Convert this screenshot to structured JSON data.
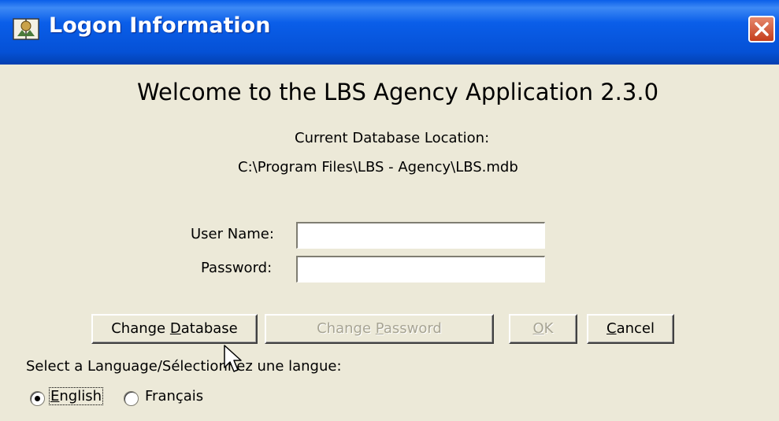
{
  "window": {
    "title": "Logon Information",
    "title_icon": "app-book-icon"
  },
  "welcome": "Welcome to the LBS Agency Application  2.3.0",
  "database": {
    "label": "Current Database Location:",
    "path": "C:\\Program Files\\LBS - Agency\\LBS.mdb"
  },
  "form": {
    "username_label": "User Name:",
    "username_value": "",
    "password_label": "Password:",
    "password_value": ""
  },
  "buttons": {
    "change_database": {
      "pre": "Change ",
      "key": "D",
      "post": "atabase"
    },
    "change_password": {
      "pre": "Change ",
      "key": "P",
      "post": "assword"
    },
    "ok": {
      "pre": "",
      "key": "O",
      "post": "K"
    },
    "cancel": {
      "pre": "",
      "key": "C",
      "post": "ancel"
    }
  },
  "language": {
    "prompt": "Select a Language/Sélectionnez une langue:",
    "options": [
      {
        "label_key": "E",
        "label_rest": "nglish",
        "selected": true
      },
      {
        "label_key": "",
        "label_rest": "Français",
        "selected": false
      }
    ]
  },
  "colors": {
    "title_bar": "#0a5ee9",
    "face": "#ece9d8",
    "close": "#c43d1c",
    "disabled_text": "#a7a493"
  }
}
